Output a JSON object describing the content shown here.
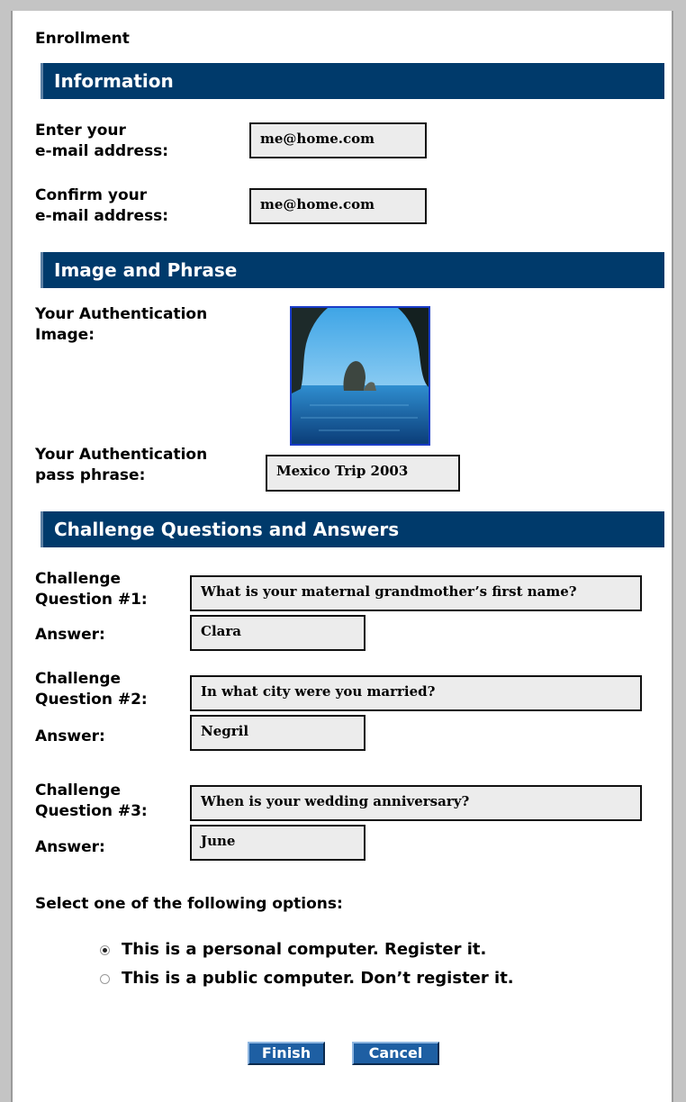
{
  "page_title": "Enrollment",
  "sections": {
    "information": "Information",
    "image_phrase": "Image and Phrase",
    "challenge": "Challenge Questions and Answers"
  },
  "email": {
    "enter_label_line1": "Enter your",
    "enter_label_line2": "e-mail address:",
    "enter_value": "me@home.com",
    "confirm_label_line1": "Confirm your",
    "confirm_label_line2": "e-mail address:",
    "confirm_value": "me@home.com"
  },
  "auth": {
    "image_label_line1": "Your Authentication",
    "image_label_line2": "Image:",
    "phrase_label_line1": "Your Authentication",
    "phrase_label_line2": "pass phrase:",
    "phrase_value": "Mexico Trip 2003"
  },
  "questions": [
    {
      "label_line1": "Challenge",
      "label_line2": "Question #1:",
      "question": "What is your maternal grandmother’s first name?",
      "answer_label": "Answer:",
      "answer": "Clara"
    },
    {
      "label_line1": "Challenge",
      "label_line2": "Question #2:",
      "question": "In what city were you married?",
      "answer_label": "Answer:",
      "answer": "Negril"
    },
    {
      "label_line1": "Challenge",
      "label_line2": "Question #3:",
      "question": "When is your wedding anniversary?",
      "answer_label": "Answer:",
      "answer": "June"
    }
  ],
  "options": {
    "prompt": "Select one of the following options:",
    "personal": "This is a personal computer. Register it.",
    "public": "This is a public computer. Don’t register it.",
    "selected": "personal"
  },
  "buttons": {
    "finish": "Finish",
    "cancel": "Cancel"
  },
  "colors": {
    "section_bar": "#003a6b",
    "button": "#1e5fa3",
    "field_bg": "#ececec"
  }
}
